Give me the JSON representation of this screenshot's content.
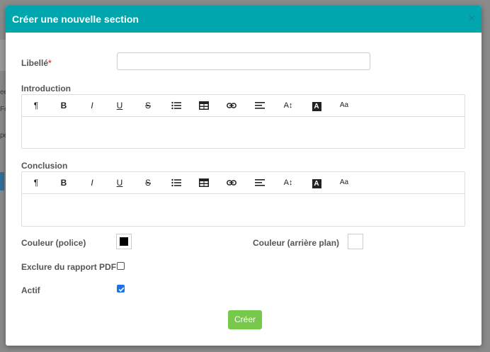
{
  "modal": {
    "title": "Créer une nouvelle section",
    "close_symbol": "×",
    "close_icon": "close-icon"
  },
  "form": {
    "libelle_label": "Libellé",
    "required_marker": "*",
    "libelle_value": "",
    "introduction_label": "Introduction",
    "conclusion_label": "Conclusion",
    "font_color_label": "Couleur (police)",
    "font_color_value": "#000000",
    "bg_color_label": "Couleur (arrière plan)",
    "bg_color_value": "#ffffff",
    "exclude_pdf_label": "Exclure du rapport PDF",
    "exclude_pdf_checked": false,
    "active_label": "Actif",
    "active_checked": true,
    "submit_label": "Créer"
  },
  "toolbar": {
    "buttons": [
      {
        "name": "paragraph-icon",
        "glyph": "¶"
      },
      {
        "name": "bold-icon",
        "glyph": "B"
      },
      {
        "name": "italic-icon",
        "glyph": "I"
      },
      {
        "name": "underline-icon",
        "glyph": "U"
      },
      {
        "name": "strikethrough-icon",
        "glyph": "S"
      },
      {
        "name": "bullet-list-icon",
        "glyph": ""
      },
      {
        "name": "table-icon",
        "glyph": ""
      },
      {
        "name": "link-icon",
        "glyph": ""
      },
      {
        "name": "align-icon",
        "glyph": ""
      },
      {
        "name": "font-size-icon",
        "glyph": "A↕"
      },
      {
        "name": "text-color-icon",
        "glyph": "A"
      },
      {
        "name": "font-style-icon",
        "glyph": "Aa"
      }
    ]
  },
  "colors": {
    "header": "#00a6ad",
    "submit": "#77c94c",
    "required": "#d9534f",
    "checkbox": "#1a73e8"
  },
  "background": {
    "glyphs": [
      "ee",
      "Fo",
      "pe"
    ]
  }
}
